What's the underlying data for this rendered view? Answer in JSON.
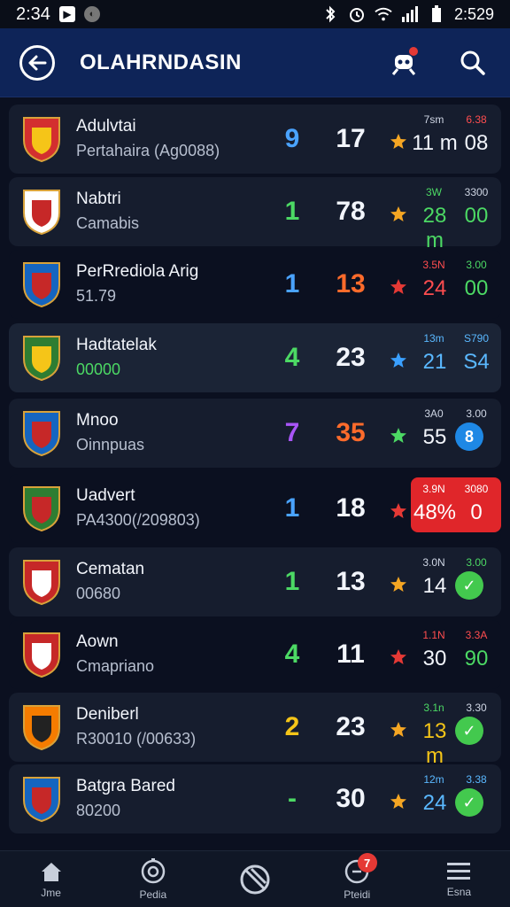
{
  "status_bar": {
    "time": "2:34",
    "right_text": "2:529"
  },
  "header": {
    "title": "OLAHRNDASIN"
  },
  "rows": [
    {
      "name": "Adulvtai",
      "sub": "Pertahaira (Ag0088)",
      "sub_green": false,
      "rank": "9",
      "rank_color": "#4aa3ff",
      "points": "17",
      "points_color": "#f2f5fb",
      "star_color": "#f5a623",
      "a_top": "7sm",
      "a_top_color": "#cfd6e4",
      "a": "11 m",
      "a_color": "#f2f5fb",
      "b_top": "6.38",
      "b_top_color": "#ff4d4f",
      "b": "08",
      "b_color": "#f2f5fb",
      "b_badge": ""
    },
    {
      "name": "Nabtri",
      "sub": "Camabis",
      "sub_green": false,
      "rank": "1",
      "rank_color": "#4cd964",
      "points": "78",
      "points_color": "#f2f5fb",
      "star_color": "#f5a623",
      "a_top": "3W",
      "a_top_color": "#4cd964",
      "a": "28 m",
      "a_color": "#4cd964",
      "b_top": "3300",
      "b_top_color": "#cfd6e4",
      "b": "00",
      "b_color": "#4cd964",
      "b_badge": ""
    },
    {
      "name": "PerRrediola Arig",
      "sub": "51.79",
      "sub_green": false,
      "rank": "1",
      "rank_color": "#4aa3ff",
      "points": "13",
      "points_color": "#ff6b2b",
      "star_color": "#e53935",
      "a_top": "3.5N",
      "a_top_color": "#ff4d4f",
      "a": "24",
      "a_color": "#ff4d4f",
      "b_top": "3.00",
      "b_top_color": "#4cd964",
      "b": "00",
      "b_color": "#4cd964",
      "b_badge": ""
    },
    {
      "name": "Hadtatelak",
      "sub": "00000",
      "sub_green": true,
      "rank": "4",
      "rank_color": "#4cd964",
      "points": "23",
      "points_color": "#f2f5fb",
      "star_color": "#3aa0ff",
      "a_top": "13m",
      "a_top_color": "#5ab8ff",
      "a": "21",
      "a_color": "#5ab8ff",
      "b_top": "S790",
      "b_top_color": "#5ab8ff",
      "b": "S4",
      "b_color": "#5ab8ff",
      "b_badge": ""
    },
    {
      "name": "Mnoo",
      "sub": "Oinnpuas",
      "sub_green": false,
      "rank": "7",
      "rank_color": "#a855f7",
      "points": "35",
      "points_color": "#ff6b2b",
      "star_color": "#4cd964",
      "a_top": "3A0",
      "a_top_color": "#cfd6e4",
      "a": "55",
      "a_color": "#f2f5fb",
      "b_top": "3.00",
      "b_top_color": "#cfd6e4",
      "b": "8",
      "b_color": "#ffffff",
      "b_badge": "#1e88e5"
    },
    {
      "name": "Uadvert",
      "sub": "PA4300(/209803)",
      "sub_green": false,
      "rank": "1",
      "rank_color": "#4aa3ff",
      "points": "18",
      "points_color": "#f2f5fb",
      "star_color": "#e53935",
      "a_top": "3.9N",
      "a_top_color": "#ffffff",
      "a": "48%",
      "a_color": "#ffffff",
      "b_top": "3080",
      "b_top_color": "#ffffff",
      "b": "0",
      "b_color": "#ffffff",
      "b_badge": ""
    },
    {
      "name": "Cematan",
      "sub": "00680",
      "sub_green": false,
      "rank": "1",
      "rank_color": "#4cd964",
      "points": "13",
      "points_color": "#f2f5fb",
      "star_color": "#f5a623",
      "a_top": "3.0N",
      "a_top_color": "#cfd6e4",
      "a": "14",
      "a_color": "#f2f5fb",
      "b_top": "3.00",
      "b_top_color": "#4cd964",
      "b": "✓",
      "b_color": "#ffffff",
      "b_badge": "#43c94e"
    },
    {
      "name": "Aown",
      "sub": "Cmapriano",
      "sub_green": false,
      "rank": "4",
      "rank_color": "#4cd964",
      "points": "11",
      "points_color": "#f2f5fb",
      "star_color": "#e53935",
      "a_top": "1.1N",
      "a_top_color": "#ff4d4f",
      "a": "30",
      "a_color": "#f2f5fb",
      "b_top": "3.3A",
      "b_top_color": "#ff4d4f",
      "b": "90",
      "b_color": "#4cd964",
      "b_badge": ""
    },
    {
      "name": "Deniberl",
      "sub": "R30010 (/00633)",
      "sub_green": false,
      "rank": "2",
      "rank_color": "#f5c518",
      "points": "23",
      "points_color": "#f2f5fb",
      "star_color": "#f5a623",
      "a_top": "3.1n",
      "a_top_color": "#4cd964",
      "a": "13 m",
      "a_color": "#f5c518",
      "b_top": "3.30",
      "b_top_color": "#cfd6e4",
      "b": "✓",
      "b_color": "#ffffff",
      "b_badge": "#43c94e"
    },
    {
      "name": "Batgra Bared",
      "sub": "80200",
      "sub_green": false,
      "rank": "-",
      "rank_color": "#4cd964",
      "points": "30",
      "points_color": "#f2f5fb",
      "star_color": "#f5a623",
      "a_top": "12m",
      "a_top_color": "#5ab8ff",
      "a": "24",
      "a_color": "#5ab8ff",
      "b_top": "3.38",
      "b_top_color": "#5ab8ff",
      "b": "✓",
      "b_color": "#ffffff",
      "b_badge": "#43c94e"
    }
  ],
  "bottom_nav": [
    {
      "label": "Jme",
      "icon": "home-icon"
    },
    {
      "label": "Pedia",
      "icon": "target-icon"
    },
    {
      "label": "",
      "icon": "ball-icon"
    },
    {
      "label": "Pteidi",
      "icon": "chat-icon",
      "badge": "7"
    },
    {
      "label": "Esna",
      "icon": "menu-icon"
    }
  ]
}
